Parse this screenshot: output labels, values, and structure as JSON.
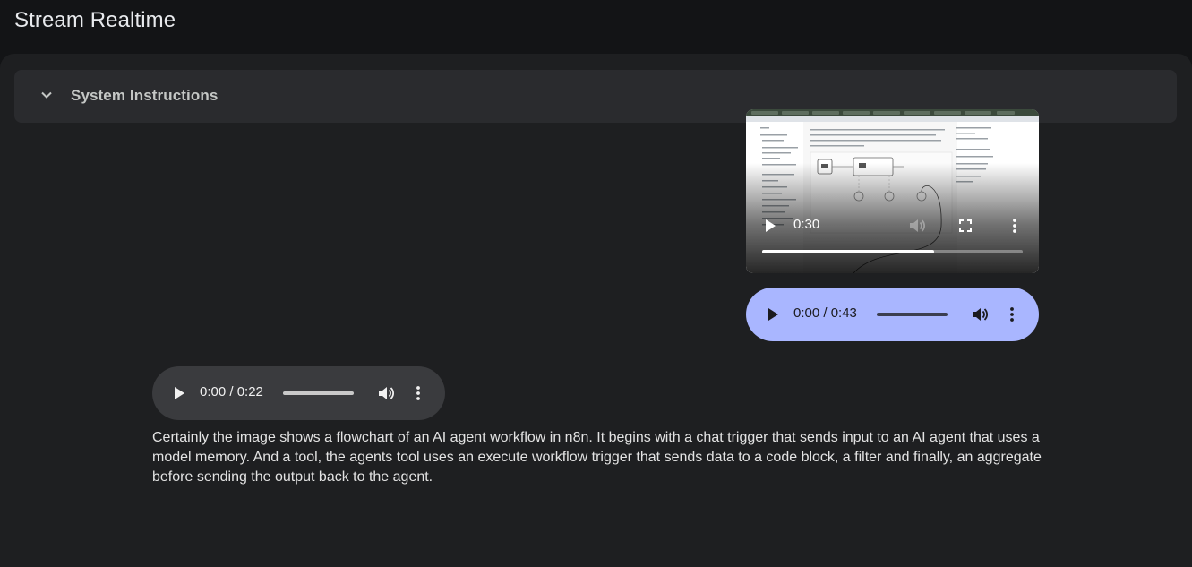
{
  "app": {
    "title": "Stream Realtime"
  },
  "system_instructions": {
    "label": "System Instructions",
    "icon": "chevron-down-icon",
    "expanded": false
  },
  "video_player": {
    "time": "0:30",
    "progress": 0.66,
    "icons": [
      "play-icon",
      "volume-icon",
      "fullscreen-icon",
      "more-vert-icon"
    ]
  },
  "audio_players": [
    {
      "time": "0:00 / 0:43",
      "progress": 0,
      "background": "#a9b6ff"
    },
    {
      "time": "0:00 / 0:22",
      "progress": 0,
      "background": "#3a3b3e"
    }
  ],
  "response": {
    "text": "Certainly the image shows a flowchart of an AI agent workflow in n8n. It begins with a chat trigger that sends input to an AI agent that uses a model memory. And a tool, the agents tool uses an execute workflow trigger that sends data to a code block, a filter and finally, an aggregate before sending the output back to the agent."
  }
}
